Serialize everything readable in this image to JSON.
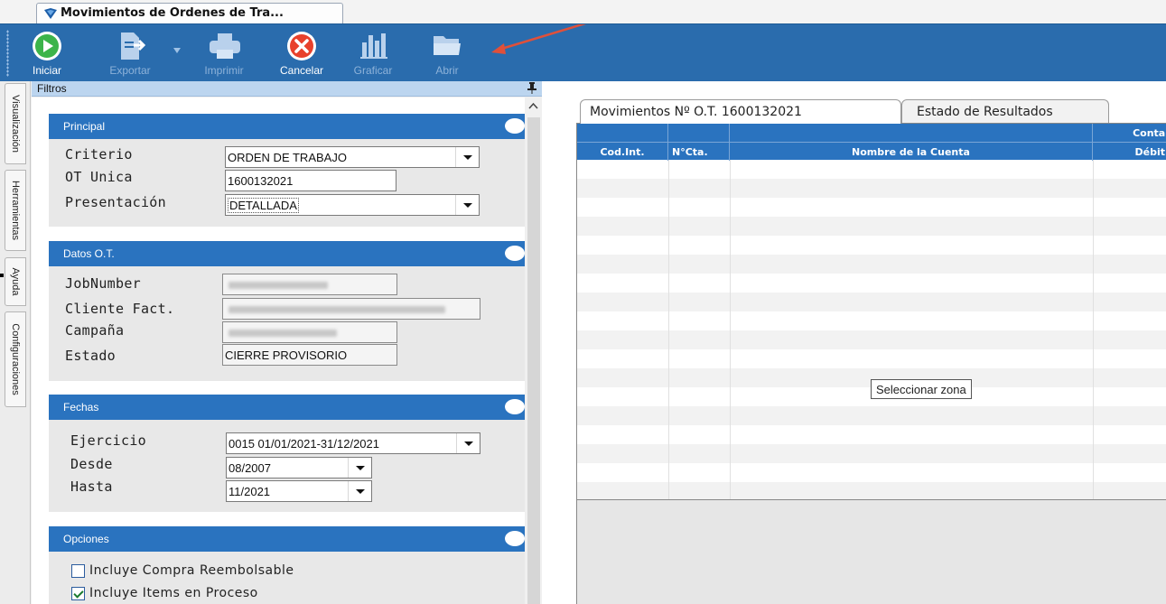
{
  "window": {
    "tab_title": "Movimientos de Ordenes de Tra..."
  },
  "toolbar": {
    "buttons": [
      {
        "label": "Iniciar",
        "icon": "play-icon",
        "enabled": true
      },
      {
        "label": "Exportar",
        "icon": "export-icon",
        "enabled": false
      },
      {
        "label": "Imprimir",
        "icon": "printer-icon",
        "enabled": false
      },
      {
        "label": "Cancelar",
        "icon": "cancel-icon",
        "enabled": true
      },
      {
        "label": "Graficar",
        "icon": "bar-chart-icon",
        "enabled": false
      },
      {
        "label": "Abrir",
        "icon": "folder-open-icon",
        "enabled": false
      }
    ]
  },
  "side_tabs": [
    "Visualización",
    "Herramientas",
    "Ayuda",
    "Configuraciones"
  ],
  "filters": {
    "title": "Filtros",
    "principal": {
      "title": "Principal",
      "criterio_label": "Criterio",
      "criterio_value": "ORDEN DE TRABAJO",
      "ot_label": "OT Unica",
      "ot_value": "1600132021",
      "presentacion_label": "Presentación",
      "presentacion_value": "DETALLADA"
    },
    "datos_ot": {
      "title": "Datos O.T.",
      "jobnumber_label": "JobNumber",
      "cliente_label": "Cliente Fact.",
      "campana_label": "Campaña",
      "estado_label": "Estado",
      "estado_value": "CIERRE PROVISORIO"
    },
    "fechas": {
      "title": "Fechas",
      "ejercicio_label": "Ejercicio",
      "ejercicio_value": "0015 01/01/2021-31/12/2021",
      "desde_label": "Desde",
      "desde_value": "08/2007",
      "hasta_label": "Hasta",
      "hasta_value": "11/2021"
    },
    "opciones": {
      "title": "Opciones",
      "items": [
        {
          "label": "Incluye Compra Reembolsable",
          "checked": false
        },
        {
          "label": "Incluye Items en Proceso",
          "checked": true
        }
      ]
    }
  },
  "results": {
    "tabs": [
      "Movimientos Nº O.T. 1600132021",
      "Estado de Resultados"
    ],
    "group_header": "Contal",
    "columns": [
      "Cod.Int.",
      "N°Cta.",
      "Nombre de la Cuenta",
      "Débit"
    ],
    "tooltip": "Seleccionar zona"
  },
  "colors": {
    "toolbar_bg": "#2a6cad",
    "group_header_bg": "#2a73bf",
    "grid_header_bg": "#2a73bf",
    "cancel_red": "#e8412c",
    "play_green": "#3cb44a"
  }
}
